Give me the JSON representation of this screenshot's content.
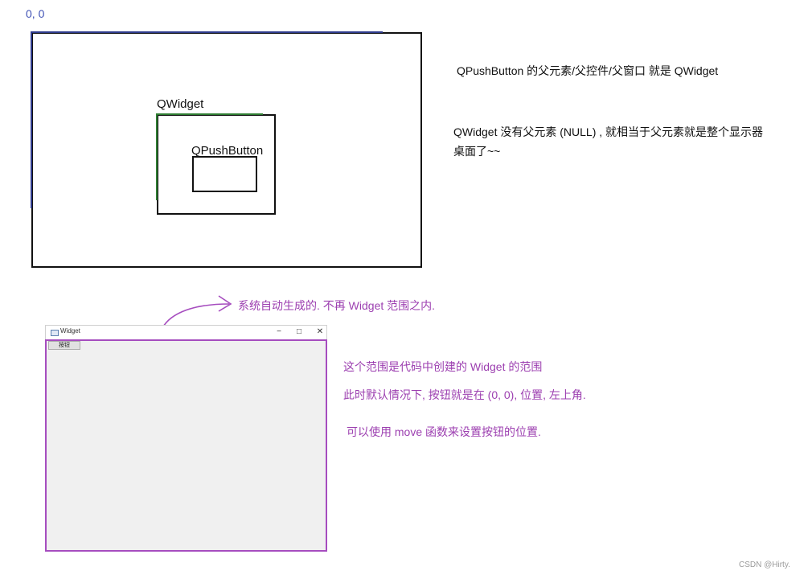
{
  "origin_label": "0, 0",
  "diagram": {
    "qwidget_label": "QWidget",
    "qpushbutton_label": "QPushButton"
  },
  "notes": {
    "parent": "QPushButton 的父元素/父控件/父窗口 就是 QWidget",
    "null_line1": "QWidget 没有父元素 (NULL) , 就相当于父元素就是整个显示器",
    "null_line2": "桌面了~~",
    "system": "系统自动生成的. 不再 Widget 范围之内.",
    "range": "这个范围是代码中创建的 Widget 的范围",
    "default": "此时默认情况下, 按钮就是在 (0, 0), 位置, 左上角.",
    "move": "可以使用 move 函数来设置按钮的位置."
  },
  "window": {
    "title": "Widget",
    "minimize": "−",
    "maximize": "□",
    "close": "✕",
    "button_label": "按钮"
  },
  "colors": {
    "blue": "#2e3a8c",
    "green": "#2e7d32",
    "purple": "#a64dbf"
  },
  "watermark": "CSDN @Hirty."
}
